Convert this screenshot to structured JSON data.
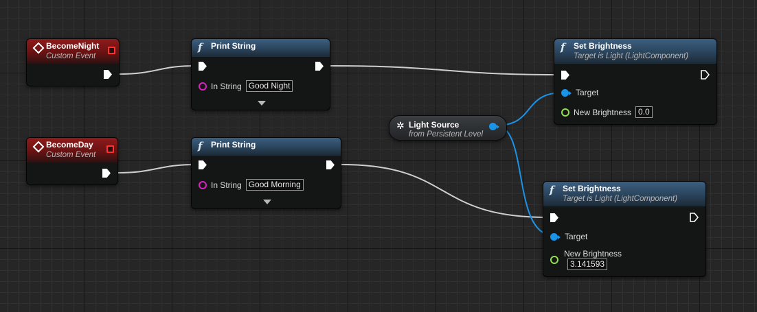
{
  "colors": {
    "exec_wire": "#d0d0d0",
    "object_wire": "#1b93e6",
    "event_header": "#8e1b1b",
    "function_header": "#3c5f80"
  },
  "nodes": {
    "become_night": {
      "title": "BecomeNight",
      "subtitle": "Custom Event",
      "icon": "event-diamond-icon"
    },
    "become_day": {
      "title": "BecomeDay",
      "subtitle": "Custom Event",
      "icon": "event-diamond-icon"
    },
    "print_night": {
      "title": "Print String",
      "icon": "function-icon",
      "in_string_label": "In String",
      "in_string_value": "Good Night"
    },
    "print_day": {
      "title": "Print String",
      "icon": "function-icon",
      "in_string_label": "In String",
      "in_string_value": "Good Morning"
    },
    "light_source": {
      "title": "Light Source",
      "subtitle": "from Persistent Level",
      "icon": "actor-reference-icon"
    },
    "set_brightness_1": {
      "title": "Set Brightness",
      "subtitle": "Target is Light (LightComponent)",
      "target_label": "Target",
      "brightness_label": "New Brightness",
      "brightness_value": "0.0"
    },
    "set_brightness_2": {
      "title": "Set Brightness",
      "subtitle": "Target is Light (LightComponent)",
      "target_label": "Target",
      "brightness_label": "New Brightness",
      "brightness_value": "3.141593"
    }
  }
}
